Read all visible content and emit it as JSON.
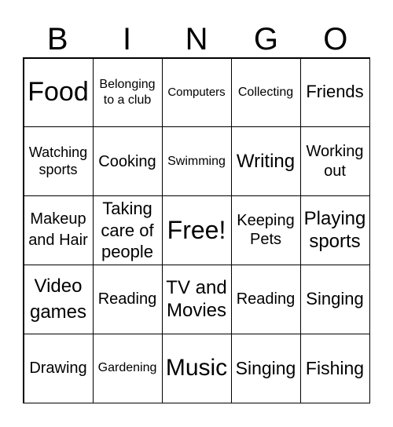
{
  "header": {
    "letters": [
      "B",
      "I",
      "N",
      "G",
      "O"
    ]
  },
  "cells": [
    "Food",
    "Belonging to a club",
    "Computers",
    "Collecting",
    "Friends",
    "Watching sports",
    "Cooking",
    "Swimming",
    "Writing",
    "Working out",
    "Makeup and Hair",
    "Taking care of people",
    "Free!",
    "Keeping Pets",
    "Playing sports",
    "Video games",
    "Reading",
    "TV and Movies",
    "Reading",
    "Singing",
    "Drawing",
    "Gardening",
    "Music",
    "Singing",
    "Fishing"
  ]
}
